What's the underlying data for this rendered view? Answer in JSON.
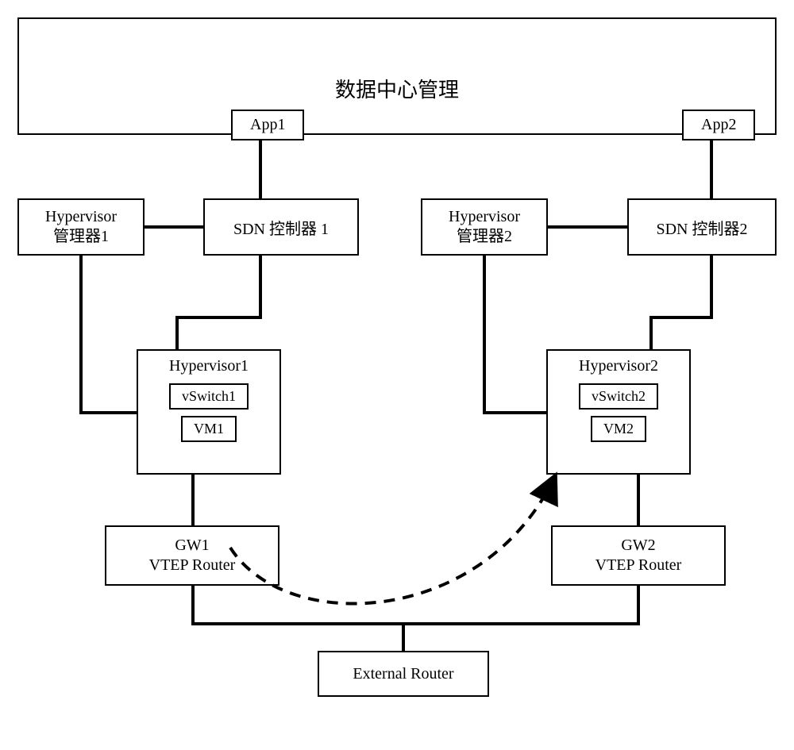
{
  "top": {
    "title": "数据中心管理",
    "app1": "App1",
    "app2": "App2"
  },
  "left": {
    "hmgr": "Hypervisor\n管理器1",
    "sdn": "SDN 控制器 1",
    "hv": {
      "title": "Hypervisor1",
      "vswitch": "vSwitch1",
      "vm": "VM1"
    },
    "gw": "GW1\nVTEP Router"
  },
  "right": {
    "hmgr": "Hypervisor\n管理器2",
    "sdn": "SDN 控制器2",
    "hv": {
      "title": "Hypervisor2",
      "vswitch": "vSwitch2",
      "vm": "VM2"
    },
    "gw": "GW2\nVTEP Router"
  },
  "ext": "External Router"
}
